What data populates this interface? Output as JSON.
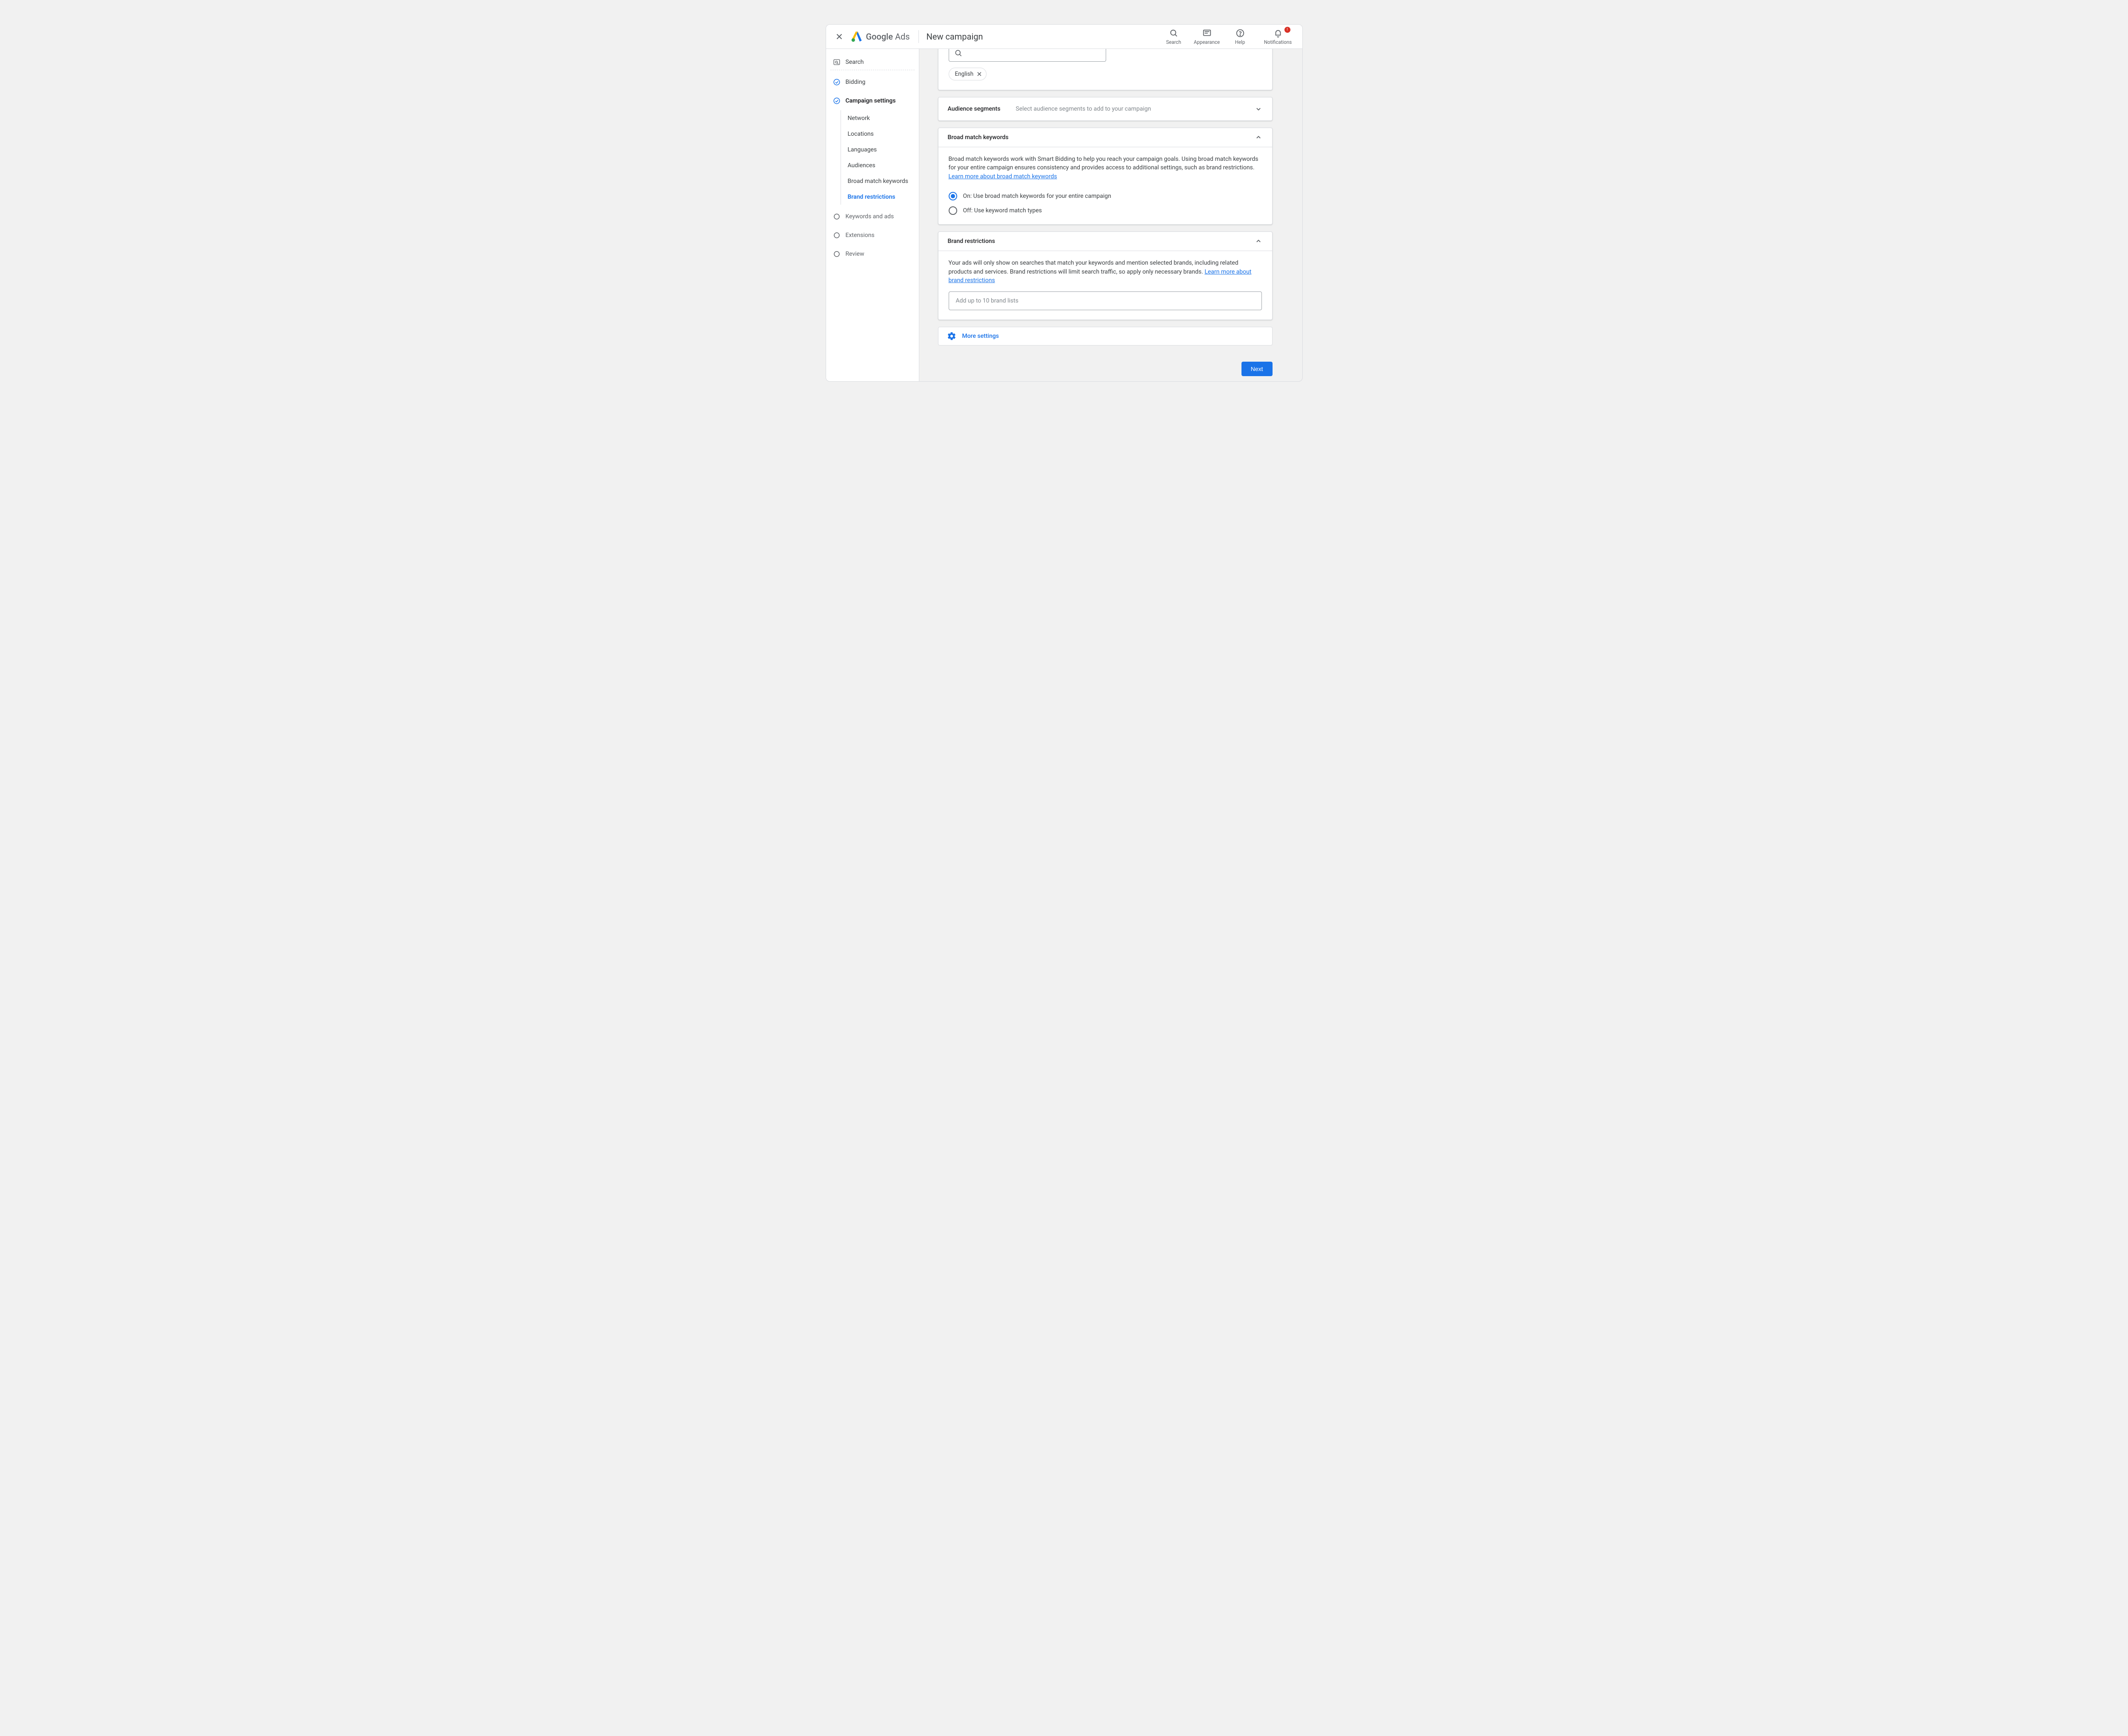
{
  "header": {
    "brand_first": "Google",
    "brand_second": "Ads",
    "page_title": "New campaign",
    "icons": {
      "search": "Search",
      "appearance": "Appearance",
      "help": "Help",
      "notifications": "Notifications"
    },
    "notification_badge": "!"
  },
  "sidebar": {
    "search": "Search",
    "steps": {
      "bidding": "Bidding",
      "campaign_settings": "Campaign settings",
      "keywords_ads": "Keywords and ads",
      "extensions": "Extensions",
      "review": "Review"
    },
    "substeps": {
      "network": "Network",
      "locations": "Locations",
      "languages": "Languages",
      "audiences": "Audiences",
      "broad_match": "Broad match keywords",
      "brand_restrictions": "Brand restrictions"
    }
  },
  "languages_card": {
    "chip": "English"
  },
  "audience_card": {
    "title": "Audience segments",
    "hint": "Select audience segments to add to your campaign"
  },
  "broad_card": {
    "title": "Broad match keywords",
    "desc": "Broad match keywords work with Smart Bidding to help you reach your campaign goals. Using broad match keywords for your entire campaign ensures consistency and provides access to additional settings, such as brand restrictions.",
    "link": "Learn more about broad match keywords",
    "radio_on": "On: Use broad match keywords for your entire campaign",
    "radio_off": "Off: Use keyword match types"
  },
  "brand_card": {
    "title": "Brand restrictions",
    "desc": "Your ads will only show on searches that match your keywords and mention selected brands, including related products and services. Brand restrictions will limit search traffic, so apply only necessary brands.  ",
    "link": "Learn more about brand restrictions",
    "input_placeholder": "Add up to 10 brand lists"
  },
  "more_settings": "More settings",
  "next_button": "Next"
}
